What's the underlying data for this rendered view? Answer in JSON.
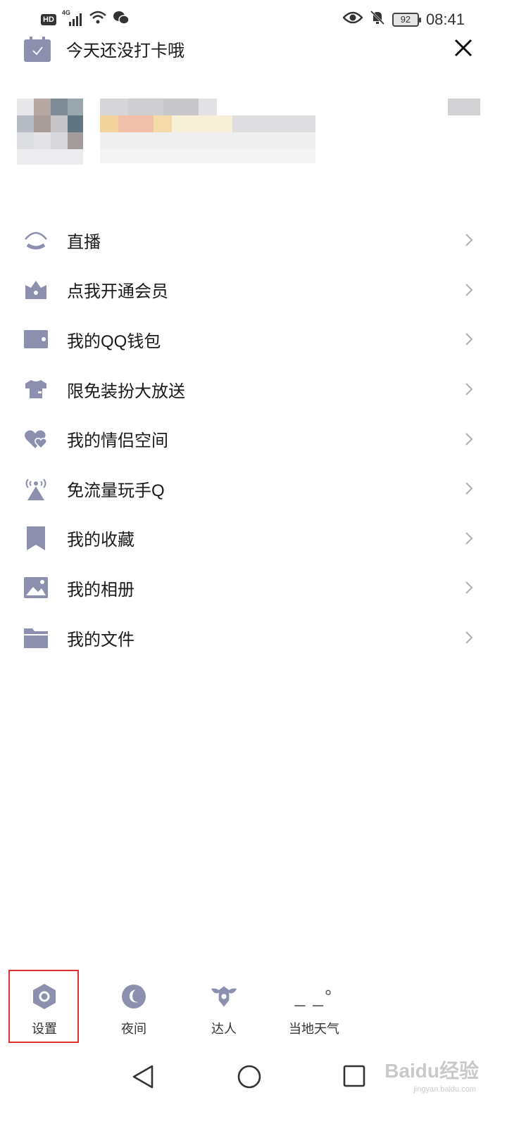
{
  "status_bar": {
    "network_label": "4G",
    "hd_label": "HD",
    "battery_level": "92",
    "time": "08:41"
  },
  "checkin": {
    "text": "今天还没打卡哦"
  },
  "menu": {
    "items": [
      {
        "label": "直播",
        "icon": "live-icon"
      },
      {
        "label": "点我开通会员",
        "icon": "membership-crown-icon"
      },
      {
        "label": "我的QQ钱包",
        "icon": "wallet-icon"
      },
      {
        "label": "限免装扮大放送",
        "icon": "tshirt-icon"
      },
      {
        "label": "我的情侣空间",
        "icon": "hearts-icon"
      },
      {
        "label": "免流量玩手Q",
        "icon": "broadcast-tower-icon"
      },
      {
        "label": "我的收藏",
        "icon": "bookmark-icon"
      },
      {
        "label": "我的相册",
        "icon": "image-icon"
      },
      {
        "label": "我的文件",
        "icon": "folder-icon"
      }
    ]
  },
  "bottom_bar": {
    "items": [
      {
        "label": "设置",
        "icon": "settings-icon"
      },
      {
        "label": "夜间",
        "icon": "moon-icon"
      },
      {
        "label": "达人",
        "icon": "talent-badge-icon"
      },
      {
        "label": "当地天气",
        "icon": "weather-icon"
      }
    ],
    "weather_value": "_ _°"
  },
  "watermark": {
    "brand": "Baidu经验",
    "url": "jingyan.baidu.com"
  },
  "colors": {
    "icon": "#8c8fae",
    "highlight": "#e03030",
    "chevron": "#b0b0b0"
  }
}
